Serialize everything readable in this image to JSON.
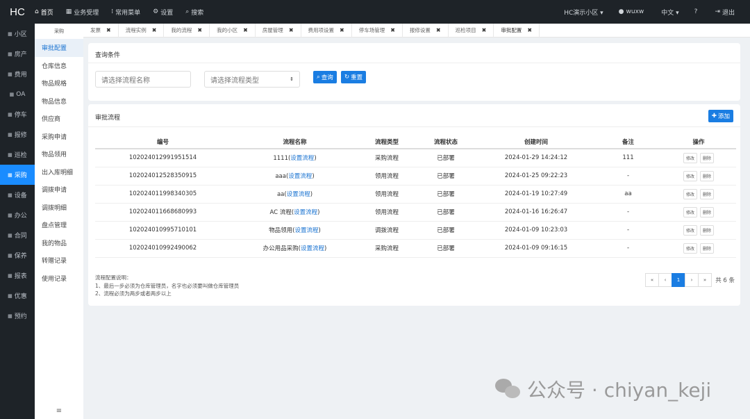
{
  "header": {
    "logo": "HC",
    "nav": [
      {
        "icon": "⌂",
        "label": "首页"
      },
      {
        "icon": "▦",
        "label": "业务受理"
      },
      {
        "icon": "⁞",
        "label": "常用菜单"
      },
      {
        "icon": "⚙",
        "label": "设置"
      },
      {
        "icon": "⌕",
        "label": "搜索"
      }
    ],
    "right": [
      {
        "icon": "",
        "label": "HC演示小区 ▾"
      },
      {
        "icon": "●",
        "label": "wuxw"
      },
      {
        "icon": "",
        "label": "中文 ▾"
      },
      {
        "icon": "?",
        "label": ""
      },
      {
        "icon": "⇥",
        "label": "退出"
      }
    ]
  },
  "leftnav": {
    "items": [
      "小区",
      "房产",
      "费用",
      "OA",
      "停车",
      "报修",
      "巡检",
      "采购",
      "设备",
      "办公",
      "合同",
      "保养",
      "报表",
      "优惠",
      "预约"
    ],
    "active": "采购"
  },
  "subnav": {
    "heading": "采购",
    "items": [
      "审批配置",
      "仓库信息",
      "物品规格",
      "物品信息",
      "供应商",
      "采购申请",
      "物品领用",
      "出入库明细",
      "调拨申请",
      "调拨明细",
      "盘点管理",
      "我的物品",
      "转赠记录",
      "使用记录"
    ],
    "active": "审批配置",
    "footer": "≡"
  },
  "tabs": [
    {
      "label": "发票"
    },
    {
      "label": "流程实例"
    },
    {
      "label": "我的流程"
    },
    {
      "label": "我的小区"
    },
    {
      "label": "房屋管理"
    },
    {
      "label": "费用项设置"
    },
    {
      "label": "停车场管理"
    },
    {
      "label": "报修设置"
    },
    {
      "label": "巡检项目"
    },
    {
      "label": "审批配置"
    }
  ],
  "query": {
    "title": "查询条件",
    "name_placeholder": "请选择流程名称",
    "type_placeholder": "请选择流程类型",
    "search_label": "查询",
    "reset_label": "重置"
  },
  "flow": {
    "title": "审批流程",
    "add_label": "添加",
    "columns": [
      "编号",
      "流程名称",
      "流程类型",
      "流程状态",
      "创建时间",
      "备注",
      "操作"
    ],
    "rows": [
      {
        "id": "102024012991951514",
        "name": "1111(",
        "link": "设置流程",
        "type": "采购流程",
        "status": "已部署",
        "time": "2024-01-29 14:24:12",
        "note": "111"
      },
      {
        "id": "102024012528350915",
        "name": "aaa(",
        "link": "设置流程",
        "type": "领用流程",
        "status": "已部署",
        "time": "2024-01-25 09:22:23",
        "note": "-"
      },
      {
        "id": "102024011998340305",
        "name": "aa(",
        "link": "设置流程",
        "type": "领用流程",
        "status": "已部署",
        "time": "2024-01-19 10:27:49",
        "note": "aa"
      },
      {
        "id": "102024011668680993",
        "name": "AC 流程(",
        "link": "设置流程",
        "type": "领用流程",
        "status": "已部署",
        "time": "2024-01-16 16:26:47",
        "note": "-"
      },
      {
        "id": "102024010995710101",
        "name": "物品领用(",
        "link": "设置流程",
        "type": "调拨流程",
        "status": "已部署",
        "time": "2024-01-09 10:23:03",
        "note": "-"
      },
      {
        "id": "102024010992490062",
        "name": "办公用品采购(",
        "link": "设置流程",
        "type": "采购流程",
        "status": "已部署",
        "time": "2024-01-09 09:16:15",
        "note": "-"
      }
    ],
    "edit_label": "修改",
    "delete_label": "删除",
    "notes": [
      "流程配置说明：",
      "1、最后一步必须为仓库管理员，名字也必须要叫做仓库管理员",
      "2、流程必须为两步或者两步以上"
    ],
    "pager": [
      "«",
      "‹",
      "1",
      "›",
      "»"
    ],
    "current_page": "1",
    "total": "共 6 条"
  },
  "watermark": "公众号 · chiyan_keji"
}
